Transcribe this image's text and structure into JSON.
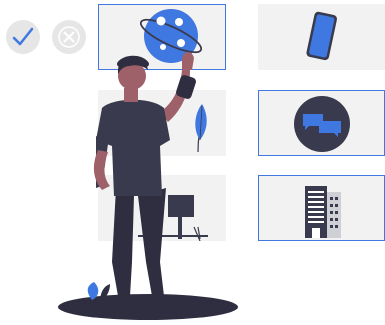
{
  "colors": {
    "accent": "#3f78e0",
    "dark": "#3a3a4e",
    "card_bg": "#f2f2f2",
    "status_bg": "#e6e6e6",
    "skin": "#9e616a",
    "shirt": "#2f2e41"
  },
  "status": [
    {
      "name": "check-icon",
      "state": "selected"
    },
    {
      "name": "close-icon",
      "state": "unselected"
    }
  ],
  "cards": [
    {
      "name": "globe-icon",
      "selected": true
    },
    {
      "name": "smartphone-icon",
      "selected": false
    },
    {
      "name": "leaf-icon",
      "selected": false
    },
    {
      "name": "chat-bubbles-icon",
      "selected": true
    },
    {
      "name": "blank-card",
      "selected": false
    },
    {
      "name": "building-icon",
      "selected": true
    }
  ],
  "figure": {
    "name": "person-illustration"
  }
}
